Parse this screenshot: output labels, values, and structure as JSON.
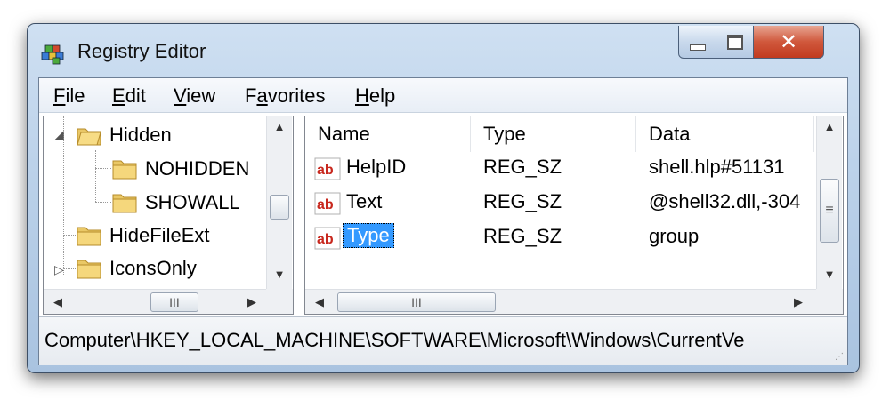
{
  "window": {
    "title": "Registry Editor",
    "min_icon": "minimize-icon",
    "max_icon": "maximize-icon",
    "close_icon": "close-icon"
  },
  "menu": [
    {
      "label": "File",
      "hot": "F",
      "rest": "ile"
    },
    {
      "label": "Edit",
      "hot": "E",
      "rest": "dit"
    },
    {
      "label": "View",
      "hot": "V",
      "rest": "iew"
    },
    {
      "label": "Favorites",
      "hot": "",
      "pre": "F",
      "hot2": "a",
      "rest": "vorites"
    },
    {
      "label": "Help",
      "hot": "H",
      "rest": "elp"
    }
  ],
  "tree": {
    "items": [
      {
        "label": "Hidden",
        "expander": "◢"
      },
      {
        "label": "NOHIDDEN"
      },
      {
        "label": "SHOWALL"
      },
      {
        "label": "HideFileExt"
      },
      {
        "label": "IconsOnly",
        "expander": "▷"
      }
    ],
    "hscroll_grip": "III"
  },
  "list": {
    "columns": [
      "Name",
      "Type",
      "Data"
    ],
    "rows": [
      {
        "name": "HelpID",
        "type": "REG_SZ",
        "data": "shell.hlp#51131"
      },
      {
        "name": "Text",
        "type": "REG_SZ",
        "data": "@shell32.dll,-304"
      },
      {
        "name": "Type",
        "type": "REG_SZ",
        "data": "group"
      }
    ],
    "hscroll_grip": "III",
    "vscroll_grip": "≡"
  },
  "status": {
    "path": "Computer\\HKEY_LOCAL_MACHINE\\SOFTWARE\\Microsoft\\Windows\\CurrentVe"
  }
}
